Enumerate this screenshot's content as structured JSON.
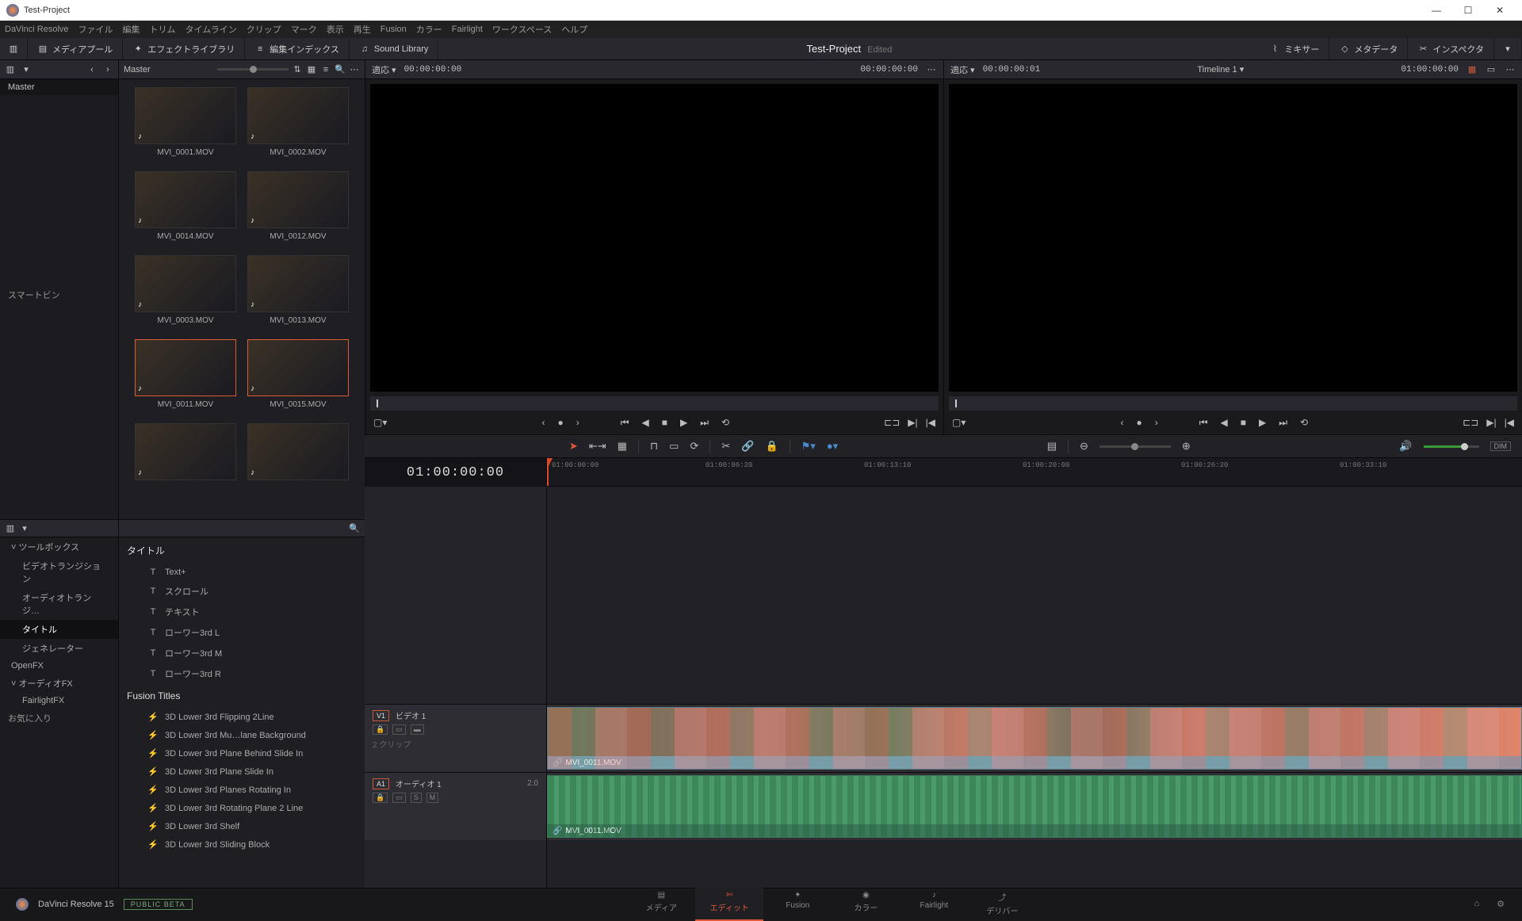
{
  "window": {
    "title": "Test-Project"
  },
  "menubar": [
    "DaVinci Resolve",
    "ファイル",
    "編集",
    "トリム",
    "タイムライン",
    "クリップ",
    "マーク",
    "表示",
    "再生",
    "Fusion",
    "カラー",
    "Fairlight",
    "ワークスペース",
    "ヘルプ"
  ],
  "toolbar": {
    "media_pool": "メディアプール",
    "effects_lib": "エフェクトライブラリ",
    "edit_index": "編集インデックス",
    "sound_lib": "Sound Library",
    "mixer": "ミキサー",
    "metadata": "メタデータ",
    "inspector": "インスペクタ",
    "project_name": "Test-Project",
    "project_status": "Edited"
  },
  "bins": {
    "master": "Master",
    "smartbin": "スマートビン",
    "favorites": "お気に入り"
  },
  "media": {
    "header_master": "Master",
    "clips": [
      {
        "name": "MVI_0001.MOV",
        "cls": "dummy-thumb-1",
        "sel": false
      },
      {
        "name": "MVI_0002.MOV",
        "cls": "dummy-thumb-2",
        "sel": false
      },
      {
        "name": "MVI_0014.MOV",
        "cls": "dummy-thumb-3",
        "sel": false
      },
      {
        "name": "MVI_0012.MOV",
        "cls": "dummy-thumb-4",
        "sel": false
      },
      {
        "name": "MVI_0003.MOV",
        "cls": "dummy-thumb-5",
        "sel": false
      },
      {
        "name": "MVI_0013.MOV",
        "cls": "dummy-thumb-6",
        "sel": false
      },
      {
        "name": "MVI_0011.MOV",
        "cls": "dummy-thumb-7",
        "sel": true
      },
      {
        "name": "MVI_0015.MOV",
        "cls": "dummy-thumb-8",
        "sel": true
      },
      {
        "name": "",
        "cls": "dummy-thumb-9",
        "sel": false
      },
      {
        "name": "",
        "cls": "dummy-thumb-10",
        "sel": false
      }
    ]
  },
  "fx_sidebar": {
    "toolbox": "ツールボックス",
    "video_trans": "ビデオトランジション",
    "audio_trans": "オーディオトランジ…",
    "titles": "タイトル",
    "generators": "ジェネレーター",
    "openfx": "OpenFX",
    "audiofx": "オーディオFX",
    "fairlightfx": "FairlightFX"
  },
  "fx_list": {
    "group1": "タイトル",
    "items1": [
      "Text+",
      "スクロール",
      "テキスト",
      "ローワー3rd L",
      "ローワー3rd M",
      "ローワー3rd R"
    ],
    "group2": "Fusion Titles",
    "items2": [
      "3D Lower 3rd Flipping 2Line",
      "3D Lower 3rd Mu…lane Background",
      "3D Lower 3rd Plane Behind Slide In",
      "3D Lower 3rd Plane Slide In",
      "3D Lower 3rd Planes Rotating In",
      "3D Lower 3rd Rotating Plane 2 Line",
      "3D Lower 3rd Shelf",
      "3D Lower 3rd Sliding Block"
    ]
  },
  "viewer_source": {
    "fit": "適応",
    "tc": "00:00:00:00",
    "tc_right": "00:00:00:00"
  },
  "viewer_timeline": {
    "fit": "適応",
    "tc": "00:00:00:01",
    "name": "Timeline 1",
    "tc_right": "01:00:00:00"
  },
  "timeline": {
    "playhead_tc": "01:00:00:00",
    "ruler": [
      "01:00:00:00",
      "01:00:06:20",
      "01:00:13:10",
      "01:00:20:00",
      "01:00:26:20",
      "01:00:33:10"
    ],
    "video_track": {
      "badge": "V1",
      "name": "ビデオ 1",
      "info": "2 クリップ"
    },
    "audio_track": {
      "badge": "A1",
      "name": "オーディオ 1",
      "ch": "2.0"
    },
    "clip_name": "MVI_0011.MOV",
    "dim": "DIM"
  },
  "bottom": {
    "brand": "DaVinci Resolve 15",
    "beta": "PUBLIC BETA",
    "pages": [
      "メディア",
      "エディット",
      "Fusion",
      "カラー",
      "Fairlight",
      "デリバー"
    ]
  }
}
